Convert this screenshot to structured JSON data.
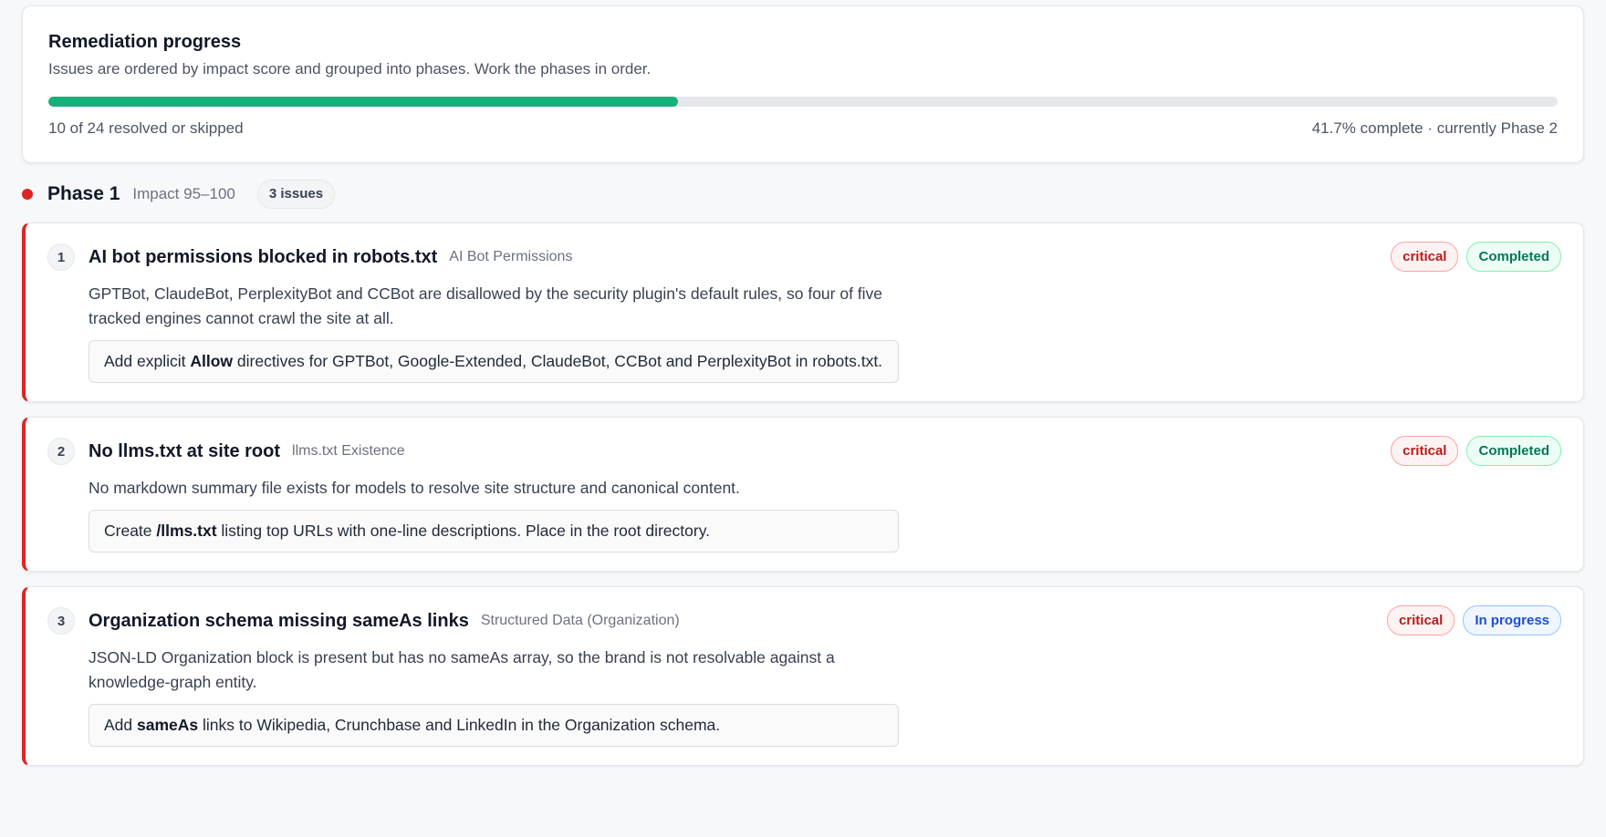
{
  "progress": {
    "title": "Remediation progress",
    "subtitle": "Issues are ordered by impact score and grouped into phases. Work the phases in order.",
    "resolved": 10,
    "total": 24,
    "fraction_complete": 0.417,
    "left_label": "10 of 24 resolved or skipped",
    "right_label": "41.7% complete · currently Phase 2",
    "accent": "#16b07a"
  },
  "phase": {
    "title": "Phase 1",
    "range": "Impact 95–100",
    "count": "3 issues",
    "color": "#dc2626"
  },
  "issues": [
    {
      "number": "1",
      "title": "AI bot permissions blocked in robots.txt",
      "category": "AI Bot Permissions",
      "severity": "critical",
      "status": "Completed",
      "description": "GPTBot, ClaudeBot, PerplexityBot and CCBot are disallowed by the security plugin's default rules, so four of five tracked engines cannot crawl the site at all.",
      "fix_before": "Add explicit ",
      "fix_bold": "Allow",
      "fix_after": " directives for GPTBot, Google-Extended, ClaudeBot, CCBot and PerplexityBot in robots.txt."
    },
    {
      "number": "2",
      "title": "No llms.txt at site root",
      "category": "llms.txt Existence",
      "severity": "critical",
      "status": "Completed",
      "description": "No markdown summary file exists for models to resolve site structure and canonical content.",
      "fix_before": "Create ",
      "fix_bold": "/llms.txt",
      "fix_after": " listing top URLs with one-line descriptions. Place in the root directory."
    },
    {
      "number": "3",
      "title": "Organization schema missing sameAs links",
      "category": "Structured Data (Organization)",
      "severity": "critical",
      "status": "In progress",
      "description": "JSON-LD Organization block is present but has no sameAs array, so the brand is not resolvable against a knowledge-graph entity.",
      "fix_before": "Add ",
      "fix_bold": "sameAs",
      "fix_after": " links to Wikipedia, Crunchbase and LinkedIn in the Organization schema."
    }
  ]
}
